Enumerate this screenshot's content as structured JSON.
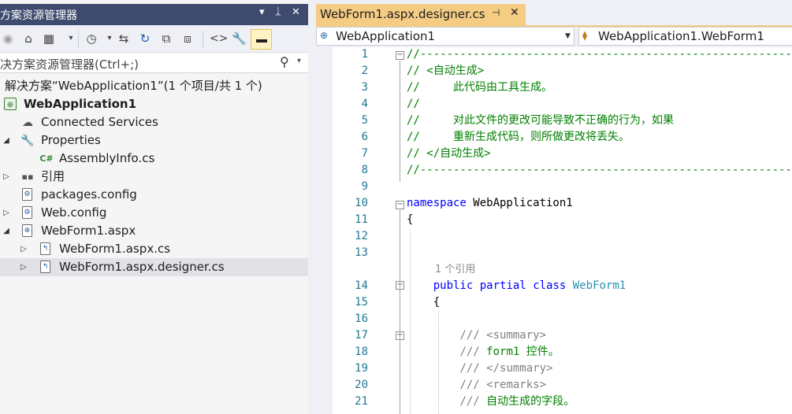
{
  "solution_explorer": {
    "title": "方案资源管理器",
    "title_controls": {
      "menu": "▾",
      "pin": "ᛣ",
      "close": "✕"
    },
    "search_placeholder": "决方案资源管理器(Ctrl+;)",
    "tree": [
      {
        "label": "解决方案“WebApplication1”(1 个项目/共 1 个)",
        "icon": "solution-icon",
        "expander": "",
        "selected": false
      },
      {
        "label": "WebApplication1",
        "icon": "web-project-icon",
        "expander": "",
        "selected": false,
        "bold": true
      },
      {
        "label": "Connected Services",
        "icon": "cloud-icon",
        "expander": "",
        "selected": false
      },
      {
        "label": "Properties",
        "icon": "wrench-icon",
        "expander": "◢",
        "selected": false
      },
      {
        "label": "AssemblyInfo.cs",
        "icon": "csharp-icon",
        "expander": "",
        "selected": false
      },
      {
        "label": "引用",
        "icon": "references-icon",
        "expander": "▷",
        "selected": false
      },
      {
        "label": "packages.config",
        "icon": "config-file-icon",
        "expander": "",
        "selected": false
      },
      {
        "label": "Web.config",
        "icon": "config-file-icon",
        "expander": "▷",
        "selected": false
      },
      {
        "label": "WebForm1.aspx",
        "icon": "web-page-icon",
        "expander": "◢",
        "selected": false
      },
      {
        "label": "WebForm1.aspx.cs",
        "icon": "code-file-icon",
        "expander": "▷",
        "selected": false
      },
      {
        "label": "WebForm1.aspx.designer.cs",
        "icon": "code-file-icon",
        "expander": "▷",
        "selected": true
      }
    ]
  },
  "editor": {
    "tab": {
      "label": "WebForm1.aspx.designer.cs",
      "pin": "⊣",
      "close": "✕"
    },
    "nav": {
      "project": "WebApplication1",
      "class": "WebApplication1.WebForm1"
    },
    "line_numbers": [
      "1",
      "2",
      "3",
      "4",
      "5",
      "6",
      "7",
      "8",
      "9",
      "10",
      "11",
      "12",
      "13",
      "14",
      "15",
      "16",
      "17",
      "18",
      "19",
      "20",
      "21"
    ],
    "code_lens": "1 个引用",
    "lines": [
      [
        {
          "c": "cm",
          "t": "//------------------------------------------------------------------------------"
        }
      ],
      [
        {
          "c": "cm",
          "t": "// <自动生成>"
        }
      ],
      [
        {
          "c": "cm",
          "t": "//     此代码由工具生成。"
        }
      ],
      [
        {
          "c": "cm",
          "t": "//"
        }
      ],
      [
        {
          "c": "cm",
          "t": "//     对此文件的更改可能导致不正确的行为，如果"
        }
      ],
      [
        {
          "c": "cm",
          "t": "//     重新生成代码，则所做更改将丢失。"
        }
      ],
      [
        {
          "c": "cm",
          "t": "// </自动生成>"
        }
      ],
      [
        {
          "c": "cm",
          "t": "//------------------------------------------------------------------------------"
        }
      ],
      [],
      [
        {
          "c": "kw",
          "t": "namespace"
        },
        {
          "c": "",
          "t": " WebApplication1"
        }
      ],
      [
        {
          "c": "",
          "t": "{"
        }
      ],
      [],
      [],
      [
        {
          "c": "",
          "t": "    "
        },
        {
          "c": "kw",
          "t": "public"
        },
        {
          "c": "",
          "t": " "
        },
        {
          "c": "kw",
          "t": "partial"
        },
        {
          "c": "",
          "t": " "
        },
        {
          "c": "kw",
          "t": "class"
        },
        {
          "c": "",
          "t": " "
        },
        {
          "c": "ty",
          "t": "WebForm1"
        }
      ],
      [
        {
          "c": "",
          "t": "    {"
        }
      ],
      [],
      [
        {
          "c": "",
          "t": "        "
        },
        {
          "c": "xd",
          "t": "/// <summary>"
        }
      ],
      [
        {
          "c": "",
          "t": "        "
        },
        {
          "c": "xd",
          "t": "/// "
        },
        {
          "c": "cm",
          "t": "form1 控件。"
        }
      ],
      [
        {
          "c": "",
          "t": "        "
        },
        {
          "c": "xd",
          "t": "/// </summary>"
        }
      ],
      [
        {
          "c": "",
          "t": "        "
        },
        {
          "c": "xd",
          "t": "/// <remarks>"
        }
      ],
      [
        {
          "c": "",
          "t": "        "
        },
        {
          "c": "xd",
          "t": "/// "
        },
        {
          "c": "cm",
          "t": "自动生成的字段。"
        }
      ]
    ]
  }
}
